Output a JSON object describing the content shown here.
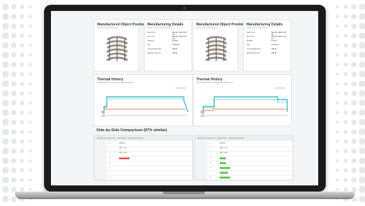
{
  "colors": {
    "bezel": "#1b1b1d",
    "screen_bg": "#f4f5f6",
    "teal": "#3cc1d2",
    "orange": "#f07a4e",
    "green": "#5cbf52",
    "red": "#e0584f",
    "blue_link": "#6b7ca5"
  },
  "panels": [
    {
      "preview": {
        "title": "Manufactured Object Preview",
        "subtitle": "Rendered 3D object preview"
      },
      "details": {
        "title": "Manufacturing Details",
        "subtitle": "Details of the manufacturing run",
        "rows": [
          {
            "key": "Start Time",
            "value": "Mar 04, 2021 3:45 pm"
          },
          {
            "key": "End Time",
            "value": "Mar 04, 2021 5:16 pm"
          },
          {
            "key": "Duration",
            "value": "1h 30m"
          },
          {
            "key": "Part",
            "value": "Ti-6Al-4V"
          },
          {
            "key": "Commanded Part",
            "value": "43419"
          },
          {
            "key": "Manager Record",
            "value": "34923"
          }
        ]
      },
      "thermal": {
        "title": "Thermal History",
        "subtitle": "Thermal history for the selected manufacturing run",
        "legend": "zoom in | out"
      }
    },
    {
      "preview": {
        "title": "Manufactured Object Preview",
        "subtitle": "Rendered 3D object preview"
      },
      "details": {
        "title": "Manufacturing Details",
        "subtitle": "Details of the manufacturing run",
        "rows": [
          {
            "key": "Start Time",
            "value": "Mar 05, 2021 4:22 pm"
          },
          {
            "key": "End Time",
            "value": "Mar 05, 2021 5:44 pm"
          },
          {
            "key": "Duration",
            "value": "1h 21m"
          },
          {
            "key": "Part",
            "value": "Ti-6Al-4V"
          },
          {
            "key": "Commanded Part",
            "value": "43419"
          },
          {
            "key": "Manager Record",
            "value": "35178"
          }
        ]
      },
      "thermal": {
        "title": "Thermal History",
        "subtitle": "Thermal history for the selected manufacturing run",
        "legend": "zoom in | out"
      }
    }
  ],
  "comparison": {
    "title": "Side-by-Side Comparison (97% similar)",
    "tables": [
      {
        "header": "Build file: box_lattice.bin — 2021-03-04 — Manufacturing Notes",
        "rows": [
          {
            "num": "1",
            "label": "abcdef",
            "pill": ""
          },
          {
            "num": "2",
            "label": "G21 ; mm",
            "pill": ""
          },
          {
            "num": "3",
            "label": "G90 ; abs",
            "pill": ""
          },
          {
            "num": "4",
            "label": "",
            "pill": "M104 S215",
            "pill_color": "#e0584f"
          },
          {
            "num": "5",
            "label": "",
            "pill": ""
          },
          {
            "num": "6",
            "label": "",
            "pill": ""
          },
          {
            "num": "7",
            "label": "",
            "pill": ""
          },
          {
            "num": "8",
            "label": "",
            "pill": ""
          }
        ]
      },
      {
        "header": "Build file: box_lattice.bin — 2021-03-05 — Manufacturing Notes",
        "rows": [
          {
            "num": "1",
            "label": "abcdef",
            "pill": ""
          },
          {
            "num": "2",
            "label": "G21 ; mm",
            "pill": ""
          },
          {
            "num": "3",
            "label": "G90 ; abs",
            "pill": ""
          },
          {
            "num": "4",
            "label": "",
            "pill": "M104",
            "pill_color": "#5cbf52"
          },
          {
            "num": "5",
            "label": "",
            "pill": "M140",
            "pill_color": "#5cbf52"
          },
          {
            "num": "6",
            "label": "",
            "pill": "G28 X0 Y0",
            "pill_color": "#5cbf52"
          },
          {
            "num": "7",
            "label": "",
            "pill": "G1 Z0.2",
            "pill_color": "#5cbf52"
          },
          {
            "num": "8",
            "label": "",
            "pill": "M109 S215",
            "pill_color": "#5cbf52"
          }
        ]
      }
    ]
  }
}
